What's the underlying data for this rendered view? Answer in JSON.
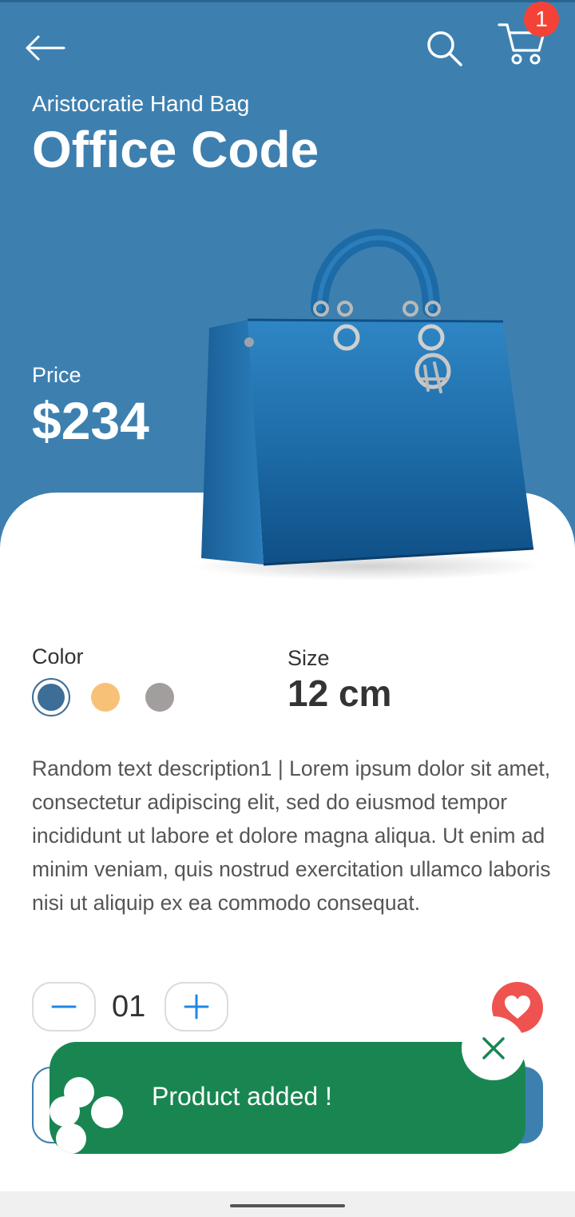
{
  "header": {
    "cart_count": "1"
  },
  "product": {
    "subtitle": "Aristocratie Hand Bag",
    "title": "Office Code",
    "price_label": "Price",
    "price": "$234"
  },
  "options": {
    "color_label": "Color",
    "colors": [
      "#3d6e98",
      "#f7c177",
      "#a39e9e"
    ],
    "selected_color": "#3d6e98",
    "size_label": "Size",
    "size_value": "12 cm"
  },
  "description": "Random text description1 | Lorem ipsum dolor sit amet, consectetur adipiscing elit, sed do eiusmod tempor incididunt ut labore et dolore magna aliqua. Ut enim ad minim veniam, quis nostrud exercitation ullamco laboris nisi ut aliquip ex ea commodo consequat.",
  "quantity": {
    "value": "01"
  },
  "toast": {
    "message": "Product added !"
  },
  "colors": {
    "hero": "#3d80b0",
    "toast": "#198651",
    "favorite": "#ef5350",
    "badge": "#f44336",
    "accent_blue": "#1e88e5"
  },
  "icons": [
    "arrow-left-icon",
    "search-icon",
    "cart-icon",
    "minus-icon",
    "plus-icon",
    "heart-icon",
    "close-icon"
  ]
}
